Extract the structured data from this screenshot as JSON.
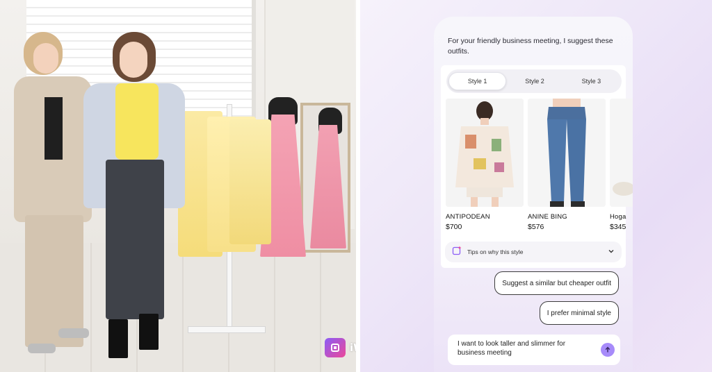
{
  "brand": {
    "name": "iWAND"
  },
  "chat": {
    "intro": "For your friendly business meeting, I suggest these outfits.",
    "tabs": [
      {
        "label": "Style 1",
        "active": true
      },
      {
        "label": "Style 2",
        "active": false
      },
      {
        "label": "Style 3",
        "active": false
      }
    ],
    "products": [
      {
        "brand": "ANTIPODEAN",
        "price": "$700"
      },
      {
        "brand": "ANINE BING",
        "price": "$576"
      },
      {
        "brand": "Hoga",
        "price": "$345"
      }
    ],
    "tips_label": "Tips on why this style",
    "suggestions": [
      "Suggest a similar but cheaper outfit",
      "I prefer minimal style"
    ],
    "input_value": "I want to look taller and slimmer for business meeting"
  },
  "colors": {
    "accent": "#a78bfa",
    "brand_gradient_start": "#8b5cf6",
    "brand_gradient_end": "#ec4899"
  }
}
